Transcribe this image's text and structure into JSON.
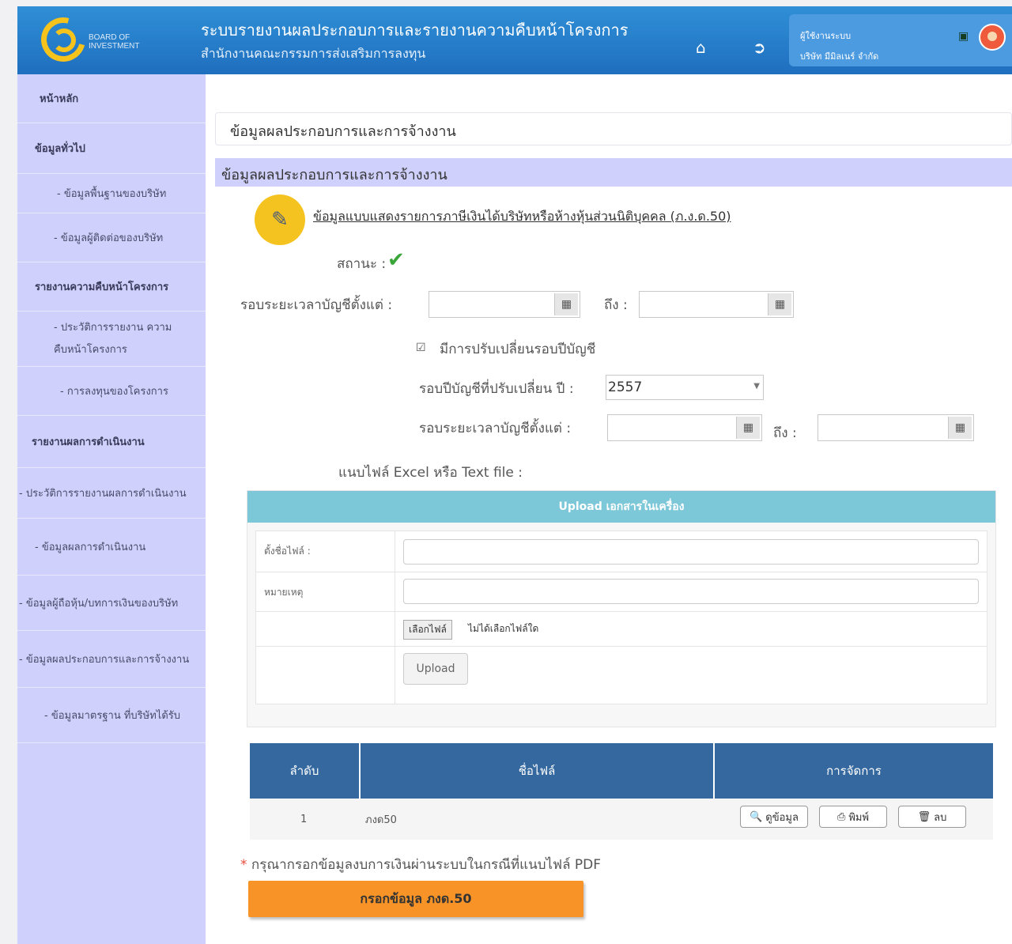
{
  "header": {
    "logo_text": "BOARD OF INVESTMENT",
    "title": "ระบบรายงานผลประกอบการและรายงานความคืบหน้าโครงการ",
    "subtitle": "สำนักงานคณะกรรมการส่งเสริมการลงทุน",
    "user_role": "ผู้ใช้งานระบบ",
    "user_company": "บริษัท มีมิลเนร์ จำกัด",
    "icons": [
      "home-icon",
      "logout-icon",
      "lock-icon",
      "avatar"
    ]
  },
  "sidebar": {
    "items": [
      {
        "label": "หน้าหลัก",
        "bold": true
      },
      {
        "label": "ข้อมูลทั่วไป",
        "bold": true
      },
      {
        "label": "- ข้อมูลพื้นฐานของบริษัท",
        "bold": false
      },
      {
        "label": "- ข้อมูลผู้ติดต่อของบริษัท",
        "bold": false
      },
      {
        "label": "รายงานความคืบหน้าโครงการ",
        "bold": true
      },
      {
        "label": "- ประวัติการรายงาน ความคืบหน้าโครงการ",
        "bold": false
      },
      {
        "label": "- การลงทุนของโครงการ",
        "bold": false
      },
      {
        "label": "รายงานผลการดำเนินงาน",
        "bold": true
      },
      {
        "label": "- ประวัติการรายงานผลการดำเนินงาน",
        "bold": false
      },
      {
        "label": "- ข้อมูลผลการดำเนินงาน",
        "bold": false
      },
      {
        "label": "- ข้อมูลผู้ถือหุ้น/บทการเงินของบริษัท",
        "bold": false
      },
      {
        "label": "- ข้อมูลผลประกอบการและการจ้างงาน",
        "bold": false
      },
      {
        "label": "- ข้อมูลมาตรฐาน ที่บริษัทได้รับ",
        "bold": false
      }
    ]
  },
  "main": {
    "section_title": "ข้อมูลผลประกอบการและการจ้างงาน",
    "panel_title": "ข้อมูลผลประกอบการและการจ้างงาน",
    "doc_link": "ข้อมูลแบบแสดงรายการภาษีเงินได้บริษัทหรือห้างหุ้นส่วนนิติบุคคล (ภ.ง.ด.50)",
    "status_label": "สถานะ :",
    "status_icon": "check-icon",
    "period_label": "รอบระยะเวลาบัญชีตั้งแต่ :",
    "to_label": "ถึง :",
    "period_from_value": "",
    "period_to_value": "",
    "change_checkbox_label": "มีการปรับเปลี่ยนรอบปีบัญชี",
    "change_year_label": "รอบปีบัญชีที่ปรับเปลี่ยน ปี :",
    "change_year_value": "2557",
    "period2_label": "รอบระยะเวลาบัญชีตั้งแต่ :",
    "to2_label": "ถึง :",
    "attach_label": "แนบไฟล์ Excel หรือ Text file :"
  },
  "upload": {
    "heading": "Upload เอกสารในเครื่อง",
    "filename_label": "ตั้งชื่อไฟล์ :",
    "note_label": "หมายเหตุ",
    "choose_file": "เลือกไฟล์",
    "no_file": "ไม่ได้เลือกไฟล์ใด",
    "upload_button": "Upload"
  },
  "file_table": {
    "headers": [
      "ลำดับ",
      "ชื่อไฟล์",
      "การจัดการ"
    ],
    "rows": [
      {
        "no": "1",
        "name": "ภงด50",
        "view": "ดูข้อมูล",
        "print": "พิมพ์",
        "delete": "ลบ"
      }
    ]
  },
  "footer": {
    "note_star": "*",
    "note": "กรุณากรอกข้อมูลงบการเงินผ่านระบบในกรณีที่แนบไฟล์ PDF",
    "fill_button": "กรอกข้อมูล ภงด.50"
  },
  "colors": {
    "header_blue": "#1f6fbf",
    "sidebar_lavender": "#cfd0fb",
    "upload_teal": "#7cc7d8",
    "table_head_blue": "#34689f",
    "fill_orange": "#f79327",
    "status_green": "#3aa63a"
  }
}
